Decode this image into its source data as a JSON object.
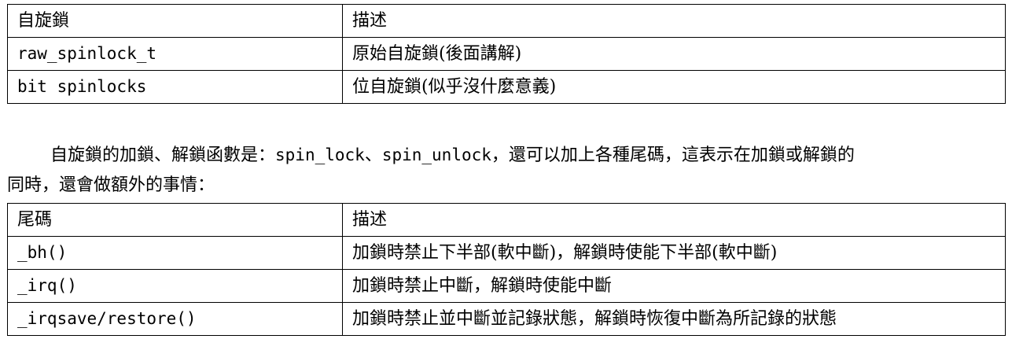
{
  "table1": {
    "headers": [
      "自旋鎖",
      "描述"
    ],
    "rows": [
      [
        "raw_spinlock_t",
        "原始自旋鎖(後面講解)"
      ],
      [
        "bit spinlocks",
        "位自旋鎖(似乎沒什麼意義)"
      ]
    ]
  },
  "paragraph": {
    "part1": "自旋鎖的加鎖、解鎖函數是：",
    "code1": "spin_lock",
    "sep": "、",
    "code2": "spin_unlock",
    "part2": "，還可以加上各種尾碼，這表示在加鎖或解鎖的",
    "line2": "同時，還會做額外的事情："
  },
  "table2": {
    "headers": [
      "尾碼",
      "描述"
    ],
    "rows": [
      [
        "_bh()",
        "加鎖時禁止下半部(軟中斷)，解鎖時使能下半部(軟中斷)"
      ],
      [
        "_irq()",
        "加鎖時禁止中斷，解鎖時使能中斷"
      ],
      [
        "_irqsave/restore()",
        "加鎖時禁止並中斷並記錄狀態，解鎖時恢復中斷為所記錄的狀態"
      ]
    ]
  }
}
